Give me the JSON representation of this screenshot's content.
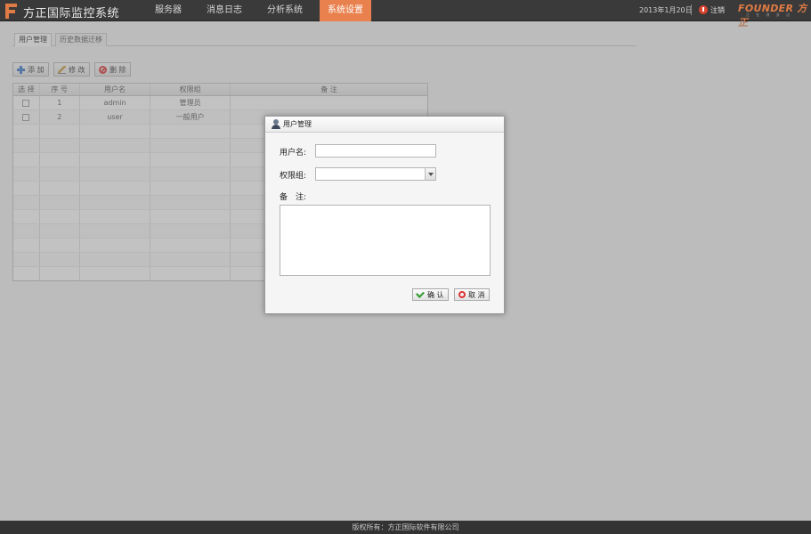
{
  "header": {
    "app_title": "方正国际监控系统",
    "nav": [
      {
        "label": "服务器"
      },
      {
        "label": "消息日志"
      },
      {
        "label": "分析系统"
      },
      {
        "label": "系统设置",
        "active": true
      }
    ],
    "date": "2013年1月20日",
    "logout": "注销",
    "brand": "FOUNDER 方正",
    "brand_sub": "正 在 改 身 边"
  },
  "tabs": [
    {
      "label": "用户管理",
      "active": true
    },
    {
      "label": "历史数据迁移"
    }
  ],
  "toolbar": {
    "add": "添 加",
    "edit": "修 改",
    "delete": "删 除"
  },
  "table": {
    "columns": [
      "选 择",
      "序 号",
      "用户名",
      "权限组",
      "备 注"
    ],
    "rows": [
      {
        "index": "1",
        "username": "admin",
        "group": "管理员",
        "note": ""
      },
      {
        "index": "2",
        "username": "user",
        "group": "一般用户",
        "note": ""
      }
    ]
  },
  "dialog": {
    "title": "用户管理",
    "username_label": "用户名:",
    "username_value": "",
    "group_label": "权限组:",
    "group_value": "",
    "note_label": "备　注:",
    "confirm": "确 认",
    "cancel": "取 消"
  },
  "footer": "版权所有：方正国际软件有限公司",
  "colors": {
    "accent": "#e9814f",
    "header_bg": "#3a3a3a"
  }
}
